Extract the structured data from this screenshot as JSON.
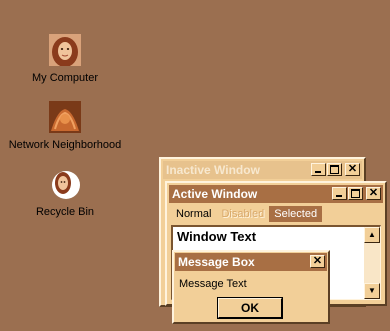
{
  "desktop": {
    "icons": [
      {
        "label": "My Computer"
      },
      {
        "label": "Network Neighborhood"
      },
      {
        "label": "Recycle Bin"
      }
    ]
  },
  "inactive_window": {
    "title": "Inactive Window"
  },
  "active_window": {
    "title": "Active Window",
    "menu": {
      "normal": "Normal",
      "disabled": "Disabled",
      "selected": "Selected"
    },
    "window_text": "Window Text"
  },
  "message_box": {
    "title": "Message Box",
    "text": "Message Text",
    "ok_label": "OK"
  },
  "colors": {
    "desktop": "#9b6f50",
    "face": "#f2cf98",
    "active_title": "#a86f44",
    "inactive_title": "#e7c28d"
  }
}
